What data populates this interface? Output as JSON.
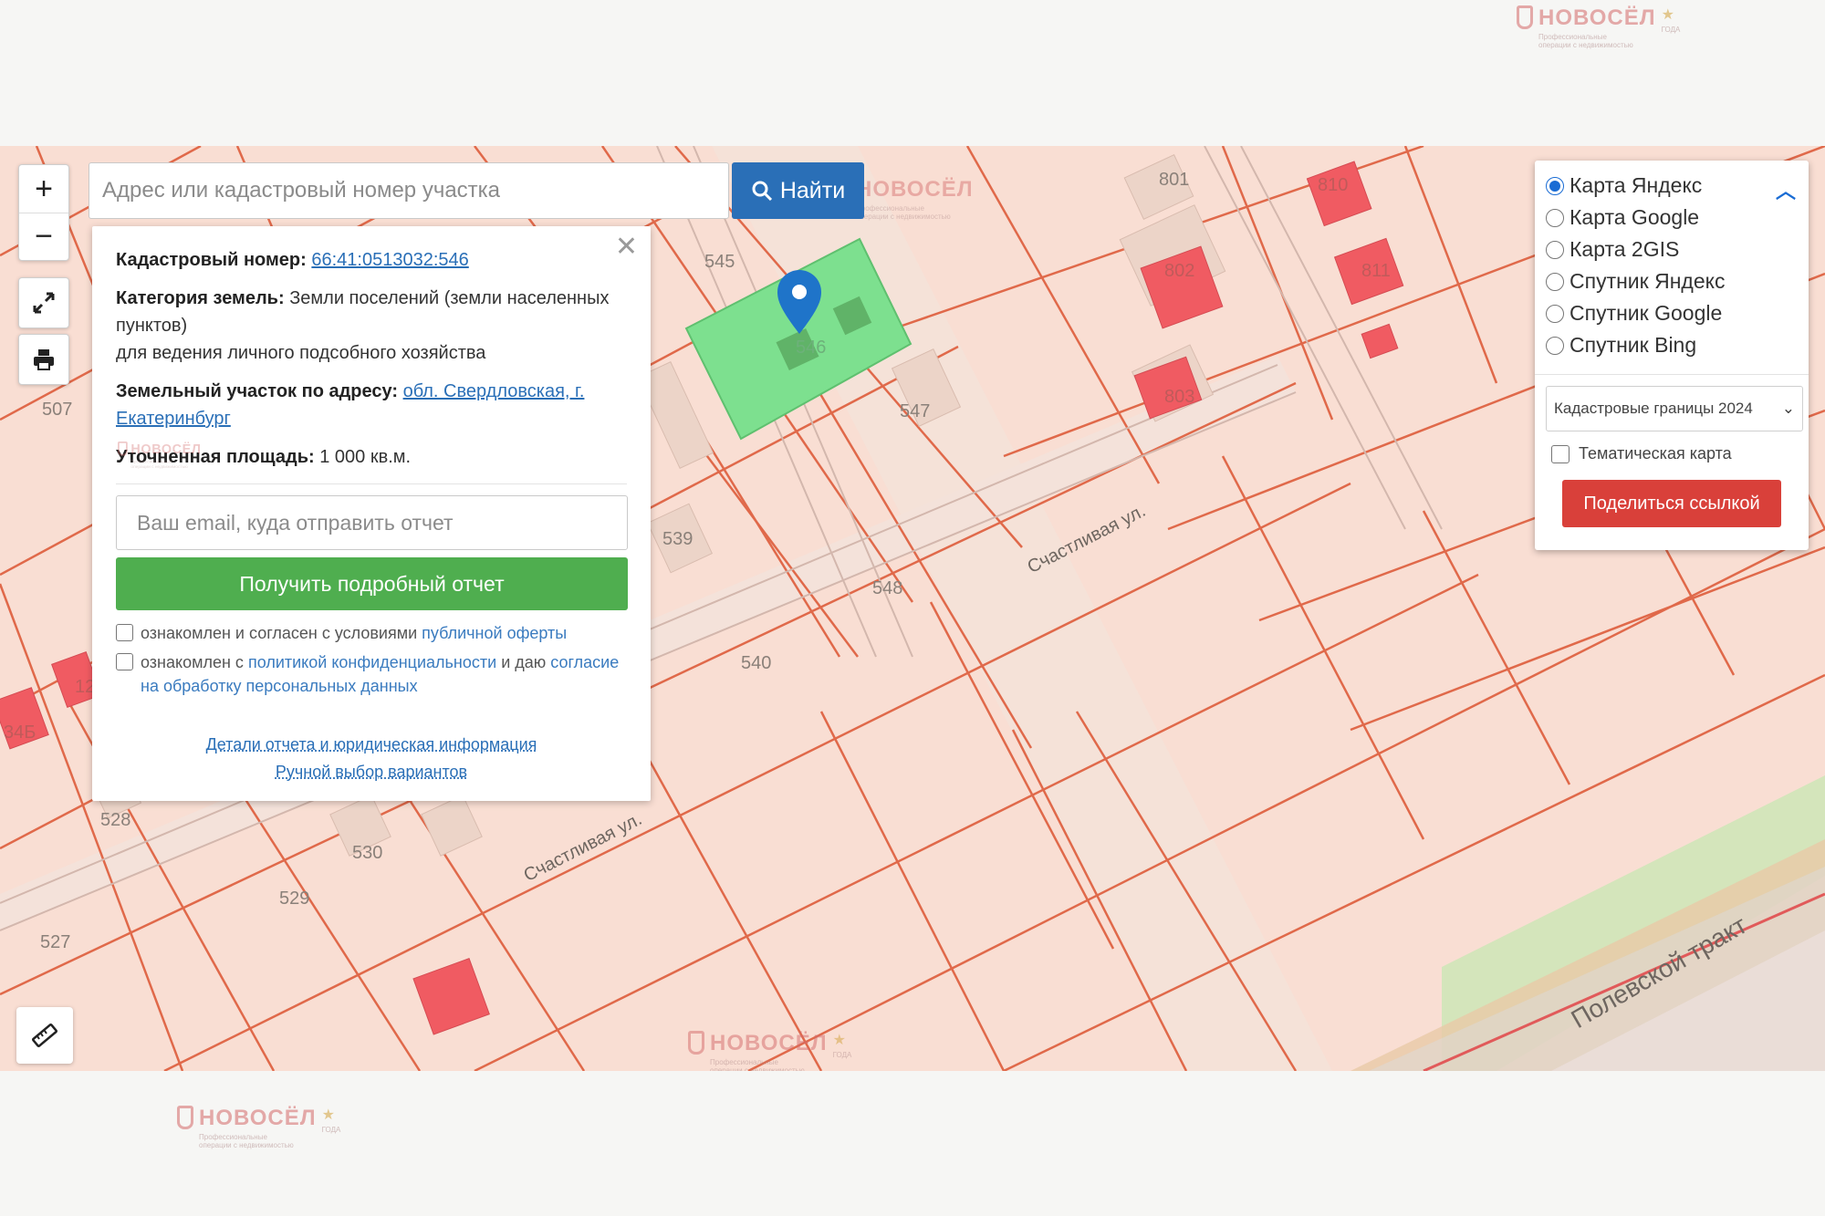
{
  "watermark": {
    "brand": "НОВОСЁЛ",
    "tagline": "Профессиональные операции с недвижимостью",
    "badge": "ГОДА"
  },
  "map": {
    "parcel_labels": [
      "545",
      "546",
      "547",
      "548",
      "539",
      "540",
      "801",
      "802",
      "803",
      "810",
      "811",
      "507",
      "528",
      "529",
      "530",
      "527",
      "12",
      "34Б"
    ],
    "streets": [
      "Счастливая ул.",
      "Счастливая ул.",
      "Полевской тракт"
    ]
  },
  "controls": {
    "zoom_in": "+",
    "zoom_out": "−",
    "fullscreen_icon": "expand-icon",
    "print_icon": "printer-icon",
    "ruler_icon": "ruler-icon"
  },
  "search": {
    "placeholder": "Адрес или кадастровый номер участка",
    "button_label": "Найти"
  },
  "info": {
    "cadastral_label": "Кадастровый номер:",
    "cadastral_value": "66:41:0513032:546",
    "category_label": "Категория земель:",
    "category_value": "Земли поселений (земли населенных пунктов)",
    "usage": "для ведения личного подсобного хозяйства",
    "address_label": "Земельный участок по адресу:",
    "address_value": "обл. Свердловская, г. Екатеринбург",
    "area_label": "Уточненная площадь:",
    "area_value": "1 000 кв.м.",
    "email_placeholder": "Ваш email, куда отправить отчет",
    "report_button": "Получить подробный отчет",
    "consent1_text": "ознакомлен и согласен с условиями",
    "consent1_link": "публичной оферты",
    "consent2_text": "ознакомлен с",
    "consent2_link": "политикой конфиденциальности",
    "consent2_mid": "и даю",
    "consent2_link2": "согласие на обработку персональных данных",
    "link_details": "Детали отчета и юридическая информация",
    "link_manual": "Ручной выбор вариантов"
  },
  "layers": {
    "options": [
      "Карта Яндекс",
      "Карта Google",
      "Карта 2GIS",
      "Спутник Яндекс",
      "Спутник Google",
      "Спутник Bing"
    ],
    "selected_index": 0,
    "select_value": "Кадастровые границы 2024",
    "thematic_label": "Тематическая карта",
    "share_button": "Поделиться ссылкой"
  },
  "colors": {
    "parcel_line": "#e0694a",
    "map_bg": "#f9ded3",
    "selected_parcel": "#7de08f",
    "building": "#f05b62",
    "accent_blue": "#2a6fb7",
    "accent_green": "#4fae4f",
    "accent_red": "#d9403a"
  }
}
